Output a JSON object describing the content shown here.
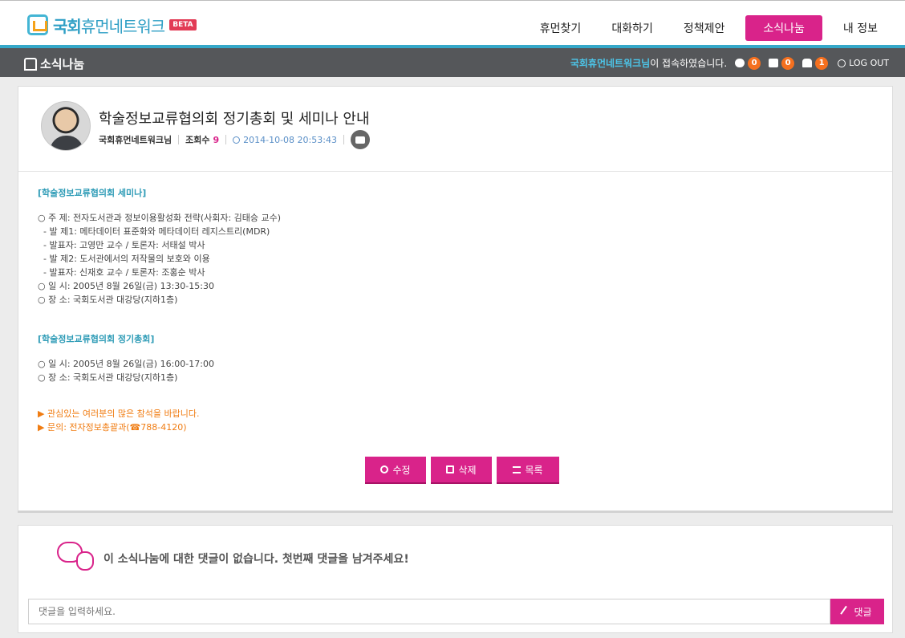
{
  "brand": {
    "name_bold": "국회",
    "name_thin": "휴먼네트워크",
    "beta": "BETA"
  },
  "nav": {
    "items": [
      {
        "label": "휴먼찾기",
        "active": false
      },
      {
        "label": "대화하기",
        "active": false
      },
      {
        "label": "정책제안",
        "active": false
      },
      {
        "label": "소식나눔",
        "active": true
      },
      {
        "label": "내 정보",
        "active": false
      }
    ]
  },
  "subbar": {
    "title": "소식나눔",
    "user_name": "국회휴먼네트워크님",
    "connected_text": "이 접속하였습니다.",
    "counts": {
      "messages": "0",
      "notices": "0",
      "friends": "1"
    },
    "logout": "LOG OUT"
  },
  "post": {
    "title": "학술정보교류협의회 정기총회 및 세미나 안내",
    "author": "국회휴먼네트워크님",
    "views_label": "조회수",
    "views": "9",
    "date": "2014-10-08 20:53:43",
    "body": {
      "sec1_title": "[학술정보교류협의회 세미나]",
      "sec1_lines": [
        "○ 주 제: 전자도서관과 정보이용활성화 전략(사회자: 김태승 교수)",
        "  - 발 제1: 메타데이터 표준화와 메타데이터 레지스트리(MDR)",
        "  - 발표자: 고영만 교수 / 토론자: 서태설 박사",
        "  - 발 제2: 도서관에서의 저작물의 보호와 이용",
        "  - 발표자: 신재호 교수 / 토론자: 조홍순 박사",
        "○ 일 시: 2005년 8월 26일(금) 13:30-15:30",
        "○ 장 소: 국회도서관 대강당(지하1층)"
      ],
      "sec2_title": "[학술정보교류협의회 정기총회]",
      "sec2_lines": [
        "○ 일 시: 2005년 8월 26일(금) 16:00-17:00",
        "○ 장 소: 국회도서관 대강당(지하1층)"
      ],
      "notes": [
        "▶ 관심있는 여러분의 많은 참석을 바랍니다.",
        "▶ 문의: 전자정보총괄과(☎788-4120)"
      ]
    },
    "actions": {
      "edit": "수정",
      "delete": "삭제",
      "list": "목록"
    }
  },
  "comments": {
    "empty_text": "이 소식나눔에 대한 댓글이 없습니다. 첫번째 댓글을 남겨주세요!",
    "input_placeholder": "댓글을 입력하세요.",
    "submit_label": "댓글"
  },
  "colors": {
    "accent": "#d9238a",
    "brand": "#2f9fc5",
    "badge": "#f5701f",
    "subbar": "#55575a"
  }
}
